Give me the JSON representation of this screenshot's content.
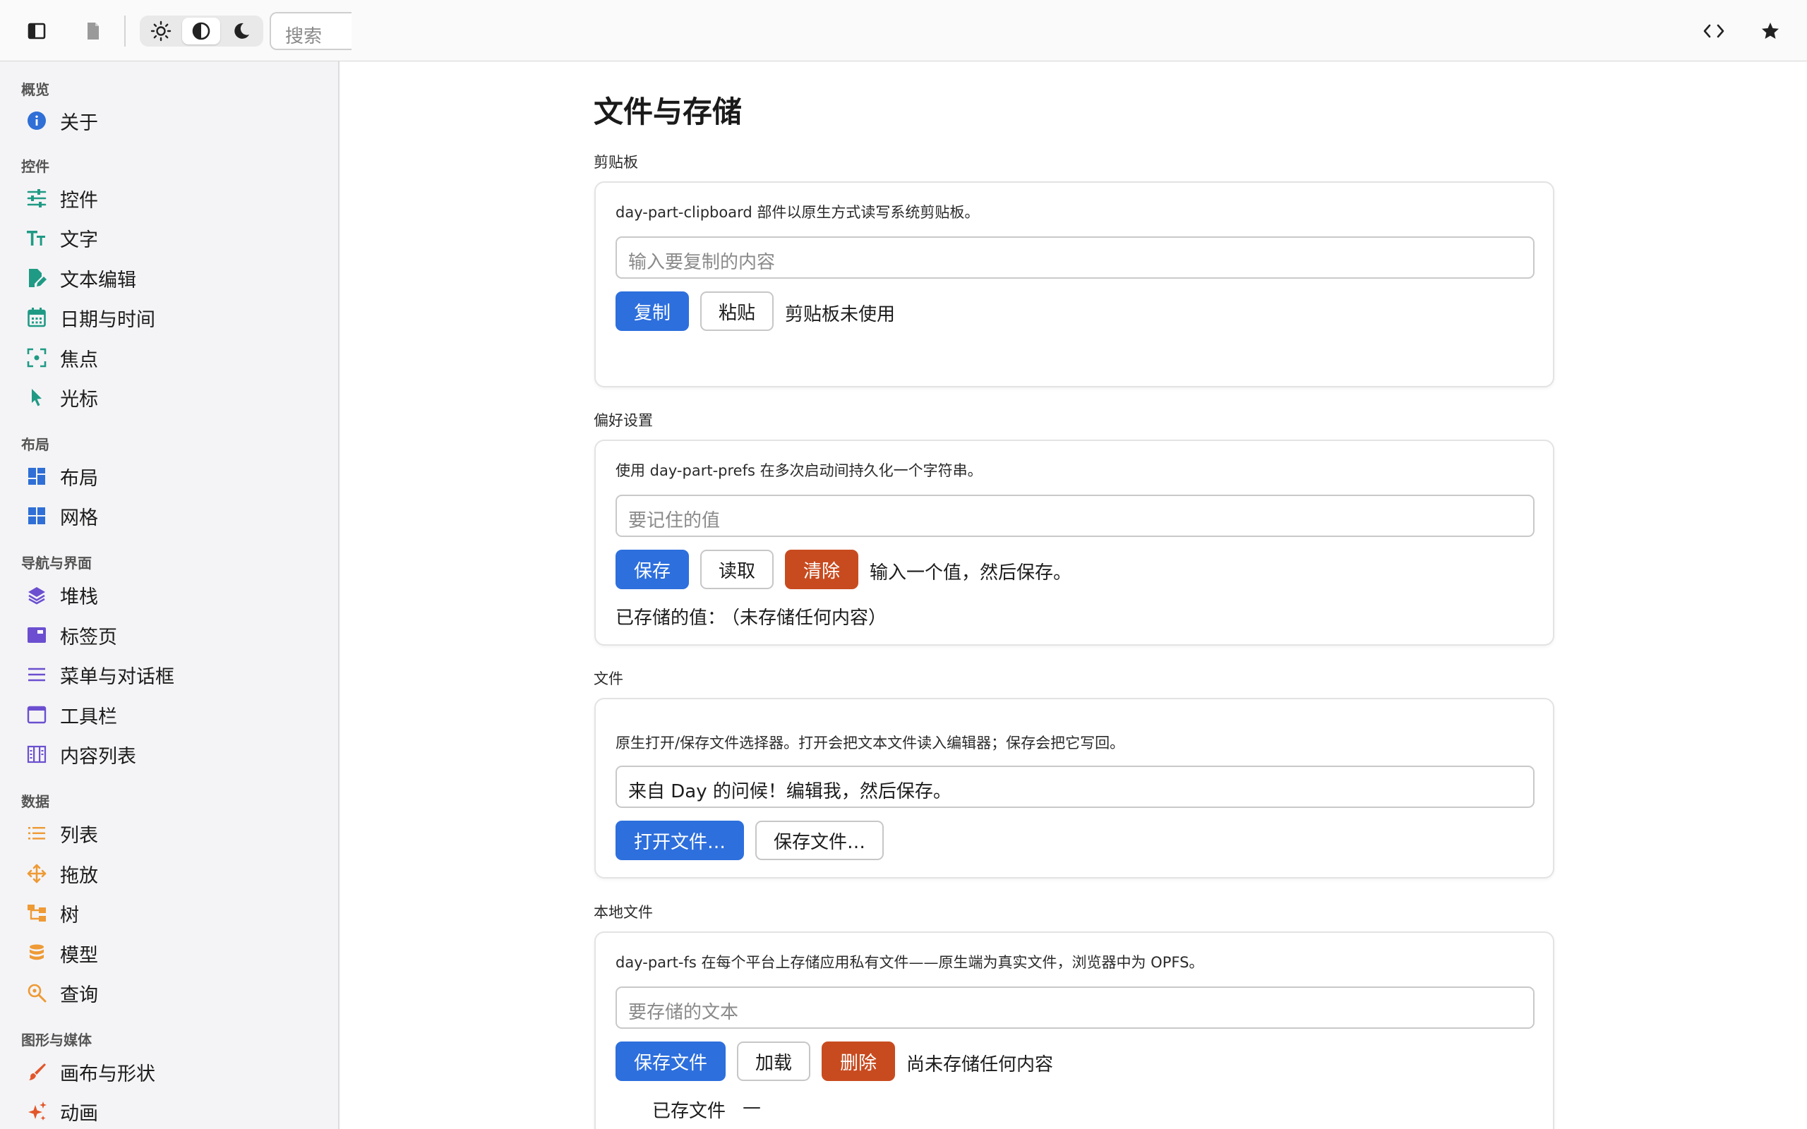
{
  "toolbar": {
    "search_placeholder": "搜索"
  },
  "sidebar": {
    "sections": {
      "overview": "概览",
      "controls": "控件",
      "layout": "布局",
      "navigation": "导航与界面",
      "data": "数据",
      "graphics": "图形与媒体"
    },
    "items": {
      "about": "关于",
      "controls": "控件",
      "text": "文字",
      "text_editing": "文本编辑",
      "date_time": "日期与时间",
      "focus": "焦点",
      "cursor": "光标",
      "layout": "布局",
      "grid": "网格",
      "stack": "堆栈",
      "tabs": "标签页",
      "menus_dialogs": "菜单与对话框",
      "toolbar": "工具栏",
      "content_list": "内容列表",
      "list": "列表",
      "drag_drop": "拖放",
      "tree": "树",
      "model": "模型",
      "query": "查询",
      "canvas_shapes": "画布与形状",
      "animation": "动画"
    }
  },
  "main": {
    "title": "文件与存储",
    "clipboard": {
      "heading": "剪贴板",
      "description": "day-part-clipboard 部件以原生方式读写系统剪贴板。",
      "placeholder": "输入要复制的内容",
      "copy_label": "复制",
      "paste_label": "粘贴",
      "status": "剪贴板未使用"
    },
    "prefs": {
      "heading": "偏好设置",
      "description": "使用 day-part-prefs 在多次启动间持久化一个字符串。",
      "placeholder": "要记住的值",
      "save_label": "保存",
      "load_label": "读取",
      "clear_label": "清除",
      "status": "输入一个值，然后保存。",
      "stored_label": "已存储的值：",
      "stored_value": "（未存储任何内容）"
    },
    "files": {
      "heading": "文件",
      "description": "原生打开/保存文件选择器。打开会把文本文件读入编辑器；保存会把它写回。",
      "value": "来自 Day 的问候！编辑我，然后保存。",
      "open_label": "打开文件…",
      "save_label": "保存文件…"
    },
    "local_files": {
      "heading": "本地文件",
      "description": "day-part-fs 在每个平台上存储应用私有文件——原生端为真实文件，浏览器中为 OPFS。",
      "placeholder": "要存储的文本",
      "save_label": "保存文件",
      "load_label": "加载",
      "delete_label": "删除",
      "status": "尚未存储任何内容",
      "saved_label": "已存文件",
      "saved_value": "—"
    }
  },
  "colors": {
    "primary": "#2d6fdd",
    "danger": "#c84b1f",
    "teal_icons": "#1f9a85",
    "blue_icons": "#2f6fd6",
    "purple_icons": "#6b4fd0",
    "orange_icons": "#ee9a35",
    "red_icons": "#e2562a"
  }
}
